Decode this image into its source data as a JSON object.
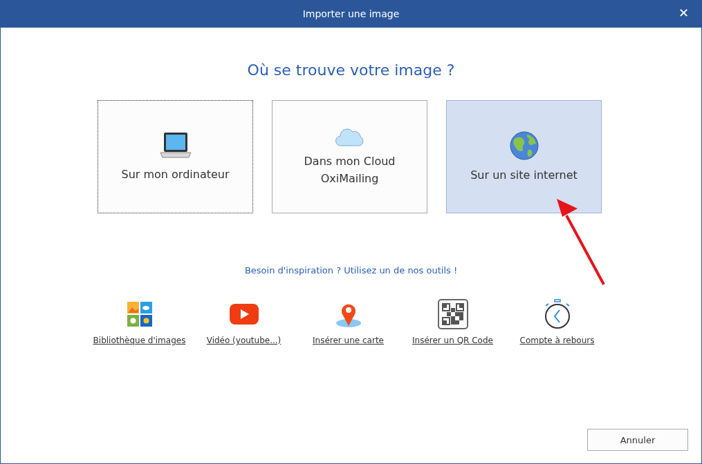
{
  "window": {
    "title": "Importer une image",
    "close": "✕"
  },
  "heading": "Où se trouve votre image ?",
  "options": [
    {
      "kind": "computer",
      "label": "Sur mon ordinateur",
      "selected": false,
      "focused": true
    },
    {
      "kind": "cloud",
      "label": "Dans mon Cloud OxiMailing",
      "selected": false,
      "focused": false
    },
    {
      "kind": "web",
      "label": "Sur un site internet",
      "selected": true,
      "focused": false
    }
  ],
  "tagline": "Besoin d'inspiration ? Utilisez un de nos outils !",
  "tools": [
    {
      "kind": "gallery",
      "label": "Bibliothèque d'images"
    },
    {
      "kind": "video",
      "label": "Vidéo (youtube...)"
    },
    {
      "kind": "map",
      "label": "Insérer une carte"
    },
    {
      "kind": "qr",
      "label": "Insérer un QR Code"
    },
    {
      "kind": "timer",
      "label": "Compte à rebours"
    }
  ],
  "buttons": [
    "Annuler"
  ]
}
